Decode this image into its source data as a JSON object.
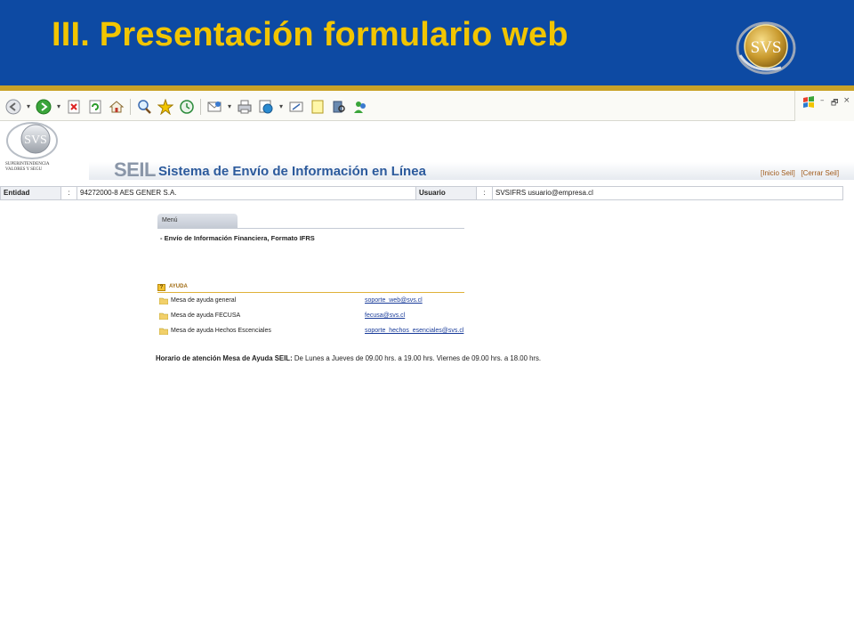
{
  "slide": {
    "title": "III. Presentación formulario web",
    "logo_text": "SVS",
    "colors": {
      "header_bg": "#0d4aa3",
      "title": "#f2c500",
      "accent_line": "#c9a227"
    }
  },
  "browser": {
    "toolbar_icons": [
      "back-icon",
      "forward-icon",
      "stop-icon",
      "refresh-icon",
      "home-icon",
      "search-icon",
      "favorites-icon",
      "history-icon",
      "mail-icon",
      "print-icon",
      "messenger-icon",
      "edit-icon",
      "notes-icon",
      "research-icon",
      "users-icon"
    ],
    "window_controls": [
      "–",
      "🗗",
      "×"
    ]
  },
  "seil": {
    "logo_caption_line1": "SUPERINTENDENCIA",
    "logo_caption_line2": "VALORES Y SEGU",
    "title": "SEIL",
    "subtitle": "Sistema de Envío de Información en Línea",
    "link_inicio": "[Inicio Seil]",
    "link_cerrar": "[Cerrar Seil]",
    "info": {
      "entidad_label": "Entidad",
      "sep1": ":",
      "entidad_value": "94272000-8   AES GENER S.A.",
      "usuario_label": "Usuario",
      "sep2": ":",
      "usuario_value": "SVSIFRS   usuario@empresa.cl"
    },
    "menu": {
      "tab_label": "Menú",
      "items": [
        "-   Envío de Información Financiera, Formato IFRS"
      ]
    },
    "ayuda": {
      "header": "AYUDA",
      "rows": [
        {
          "name": "Mesa de ayuda general",
          "email": "soporte_web@svs.cl"
        },
        {
          "name": "Mesa de ayuda FECUSA",
          "email": "fecusa@svs.cl"
        },
        {
          "name": "Mesa de ayuda Hechos Escenciales",
          "email": "soporte_hechos_esenciales@svs.cl"
        }
      ]
    },
    "horario": {
      "label": "Horario de atención Mesa de Ayuda SEIL:",
      "text": " De Lunes a Jueves de 09.00 hrs. a 19.00 hrs. Viernes de 09.00 hrs. a 18.00 hrs."
    }
  }
}
